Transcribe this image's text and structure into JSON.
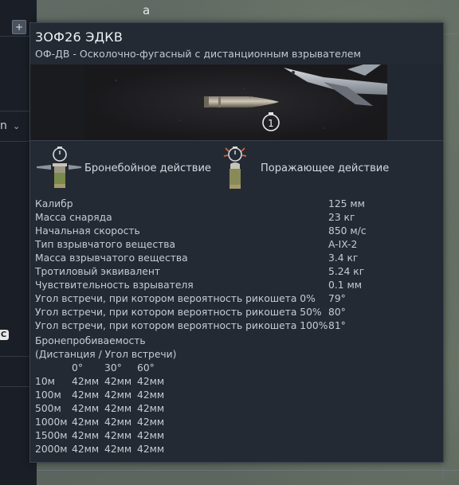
{
  "background": {
    "map_label": "a",
    "left_letter": "n",
    "plus_label": "+",
    "marker_label": "C"
  },
  "shell": {
    "title": "3ОФ26 ЭДКВ",
    "subtitle": "ОФ-ДВ - Осколочно-фугасный с дистанционным взрывателем",
    "preview_badge": "1"
  },
  "actions": {
    "armor_piercing": "Бронебойное действие",
    "damaging": "Поражающее действие"
  },
  "params": [
    {
      "name": "Калибр",
      "value": "125 мм"
    },
    {
      "name": "Масса снаряда",
      "value": "23 кг"
    },
    {
      "name": "Начальная скорость",
      "value": "850 м/с"
    },
    {
      "name": "Тип взрывчатого вещества",
      "value": "A-IX-2"
    },
    {
      "name": "Масса взрывчатого вещества",
      "value": "3.4 кг"
    },
    {
      "name": "Тротиловый эквивалент",
      "value": "5.24 кг"
    },
    {
      "name": "Чувствительность взрывателя",
      "value": "0.1 мм"
    },
    {
      "name": "Угол встречи, при котором вероятность рикошета 0%",
      "value": "79°"
    },
    {
      "name": "Угол встречи, при котором вероятность рикошета 50%",
      "value": "80°"
    },
    {
      "name": "Угол встречи, при котором вероятность рикошета 100%",
      "value": "81°"
    }
  ],
  "penetration": {
    "title": "Бронепробиваемость",
    "subtitle": "(Дистанция / Угол встречи)",
    "angles": [
      "0°",
      "30°",
      "60°"
    ],
    "rows": [
      {
        "distance": "10м",
        "values": [
          "42мм",
          "42мм",
          "42мм"
        ]
      },
      {
        "distance": "100м",
        "values": [
          "42мм",
          "42мм",
          "42мм"
        ]
      },
      {
        "distance": "500м",
        "values": [
          "42мм",
          "42мм",
          "42мм"
        ]
      },
      {
        "distance": "1000м",
        "values": [
          "42мм",
          "42мм",
          "42мм"
        ]
      },
      {
        "distance": "1500м",
        "values": [
          "42мм",
          "42мм",
          "42мм"
        ]
      },
      {
        "distance": "2000м",
        "values": [
          "42мм",
          "42мм",
          "42мм"
        ]
      }
    ]
  },
  "colors": {
    "panel": "#242a33",
    "text": "#c6ccd4",
    "title": "#eef1f5"
  },
  "icons": [
    "stopwatch-icon",
    "shell-armor-piercing-icon",
    "shell-damaging-icon",
    "aircraft-icon",
    "projectile-icon"
  ]
}
